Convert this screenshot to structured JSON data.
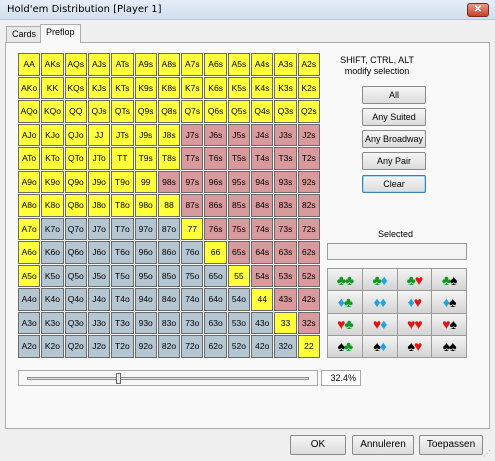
{
  "window": {
    "title": "Hold'em Distribution [Player 1]",
    "close_glyph": "✕"
  },
  "tabs": [
    {
      "label": "Cards"
    },
    {
      "label": "Preflop"
    }
  ],
  "range_grid": {
    "ranks": [
      "A",
      "K",
      "Q",
      "J",
      "T",
      "9",
      "8",
      "7",
      "6",
      "5",
      "4",
      "3",
      "2"
    ],
    "selected_percent": 32.4
  },
  "modifiers": {
    "line1": "SHIFT, CTRL, ALT",
    "line2": "modify selection"
  },
  "buttons": {
    "all": "All",
    "any_suited": "Any Suited",
    "any_broadway": "Any Broadway",
    "any_pair": "Any Pair",
    "clear": "Clear"
  },
  "selected": {
    "label": "Selected",
    "value": ""
  },
  "suits": {
    "rows": [
      [
        [
          "club",
          "club"
        ],
        [
          "club",
          "diamond"
        ],
        [
          "club",
          "heart"
        ],
        [
          "club",
          "spade"
        ]
      ],
      [
        [
          "diamond",
          "club"
        ],
        [
          "diamond",
          "diamond"
        ],
        [
          "diamond",
          "heart"
        ],
        [
          "diamond",
          "spade"
        ]
      ],
      [
        [
          "heart",
          "club"
        ],
        [
          "heart",
          "diamond"
        ],
        [
          "heart",
          "heart"
        ],
        [
          "heart",
          "spade"
        ]
      ],
      [
        [
          "spade",
          "club"
        ],
        [
          "spade",
          "diamond"
        ],
        [
          "spade",
          "heart"
        ],
        [
          "spade",
          "spade"
        ]
      ]
    ],
    "colors": {
      "club": "#11991f",
      "diamond": "#20a4e0",
      "heart": "#e01515",
      "spade": "#000000"
    }
  },
  "slider": {
    "value_label": "32.4%"
  },
  "footer": {
    "ok": "OK",
    "cancel": "Annuleren",
    "apply": "Toepassen"
  },
  "colors": {
    "selected": "#ffff3a",
    "suited": "#d89a9c",
    "offsuit": "#b4c6d2"
  }
}
